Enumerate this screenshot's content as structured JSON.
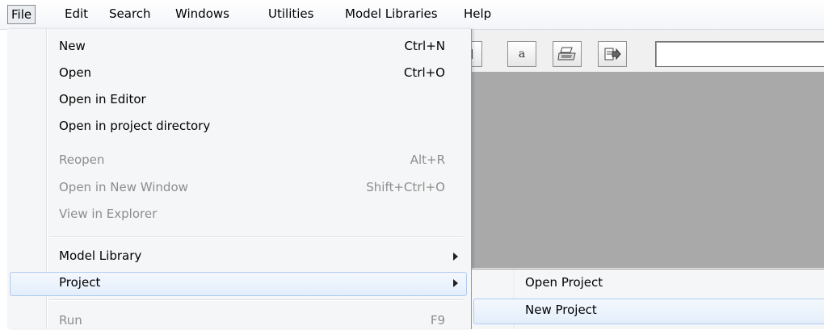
{
  "menubar": {
    "items": [
      "File",
      "Edit",
      "Search",
      "Windows",
      "Utilities",
      "Model Libraries",
      "Help"
    ]
  },
  "toolbar": {
    "letter_button": "a",
    "text_box_value": ""
  },
  "file_menu": {
    "items": [
      {
        "label": "New",
        "shortcut": "Ctrl+N",
        "enabled": true
      },
      {
        "label": "Open",
        "shortcut": "Ctrl+O",
        "enabled": true
      },
      {
        "label": "Open in Editor",
        "shortcut": "",
        "enabled": true
      },
      {
        "label": "Open in project directory",
        "shortcut": "",
        "enabled": true
      },
      {
        "label": "Reopen",
        "shortcut": "Alt+R",
        "enabled": false
      },
      {
        "label": "Open in New Window",
        "shortcut": "Shift+Ctrl+O",
        "enabled": false
      },
      {
        "label": "View in Explorer",
        "shortcut": "",
        "enabled": false
      },
      {
        "label": "Model Library",
        "shortcut": "",
        "enabled": true,
        "submenu": true
      },
      {
        "label": "Project",
        "shortcut": "",
        "enabled": true,
        "submenu": true,
        "highlighted": true
      },
      {
        "label": "Run",
        "shortcut": "F9",
        "enabled": false
      }
    ]
  },
  "project_submenu": {
    "items": [
      {
        "label": "Open Project"
      },
      {
        "label": "New Project",
        "highlighted": true
      }
    ]
  },
  "colors": {
    "highlight_border": "#aecbef",
    "highlight_fill": "#e3eefb",
    "workspace": "#a9a9a9",
    "disabled_text": "#8d8d8d"
  }
}
